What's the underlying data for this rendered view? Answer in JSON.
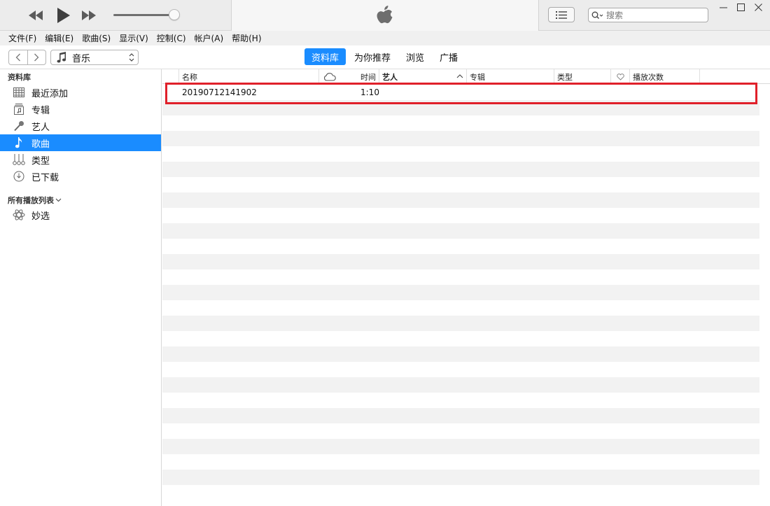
{
  "menu": [
    "文件(F)",
    "编辑(E)",
    "歌曲(S)",
    "显示(V)",
    "控制(C)",
    "帐户(A)",
    "帮助(H)"
  ],
  "search": {
    "placeholder": "搜索"
  },
  "volume": {
    "level": 0.9
  },
  "media": {
    "selected": "音乐"
  },
  "tabs": [
    {
      "label": "资料库",
      "active": true
    },
    {
      "label": "为你推荐",
      "active": false
    },
    {
      "label": "浏览",
      "active": false
    },
    {
      "label": "广播",
      "active": false
    }
  ],
  "sidebar": {
    "library_title": "资料库",
    "library_items": [
      {
        "label": "最近添加",
        "icon": "grid-icon"
      },
      {
        "label": "专辑",
        "icon": "album-icon"
      },
      {
        "label": "艺人",
        "icon": "microphone-icon"
      },
      {
        "label": "歌曲",
        "icon": "music-note-icon",
        "selected": true
      },
      {
        "label": "类型",
        "icon": "genre-icon"
      },
      {
        "label": "已下载",
        "icon": "download-clock-icon"
      }
    ],
    "playlists_title": "所有播放列表",
    "playlist_items": [
      {
        "label": "妙选",
        "icon": "genius-atom-icon"
      }
    ]
  },
  "table": {
    "columns": {
      "name": "名称",
      "time": "时间",
      "artist": "艺人",
      "album": "专辑",
      "genre": "类型",
      "plays": "播放次数"
    },
    "songs": [
      {
        "name": "20190712141902",
        "time": "1:10"
      }
    ]
  },
  "colors": {
    "accent": "#1a8cff",
    "highlight_box": "#e0202a"
  }
}
